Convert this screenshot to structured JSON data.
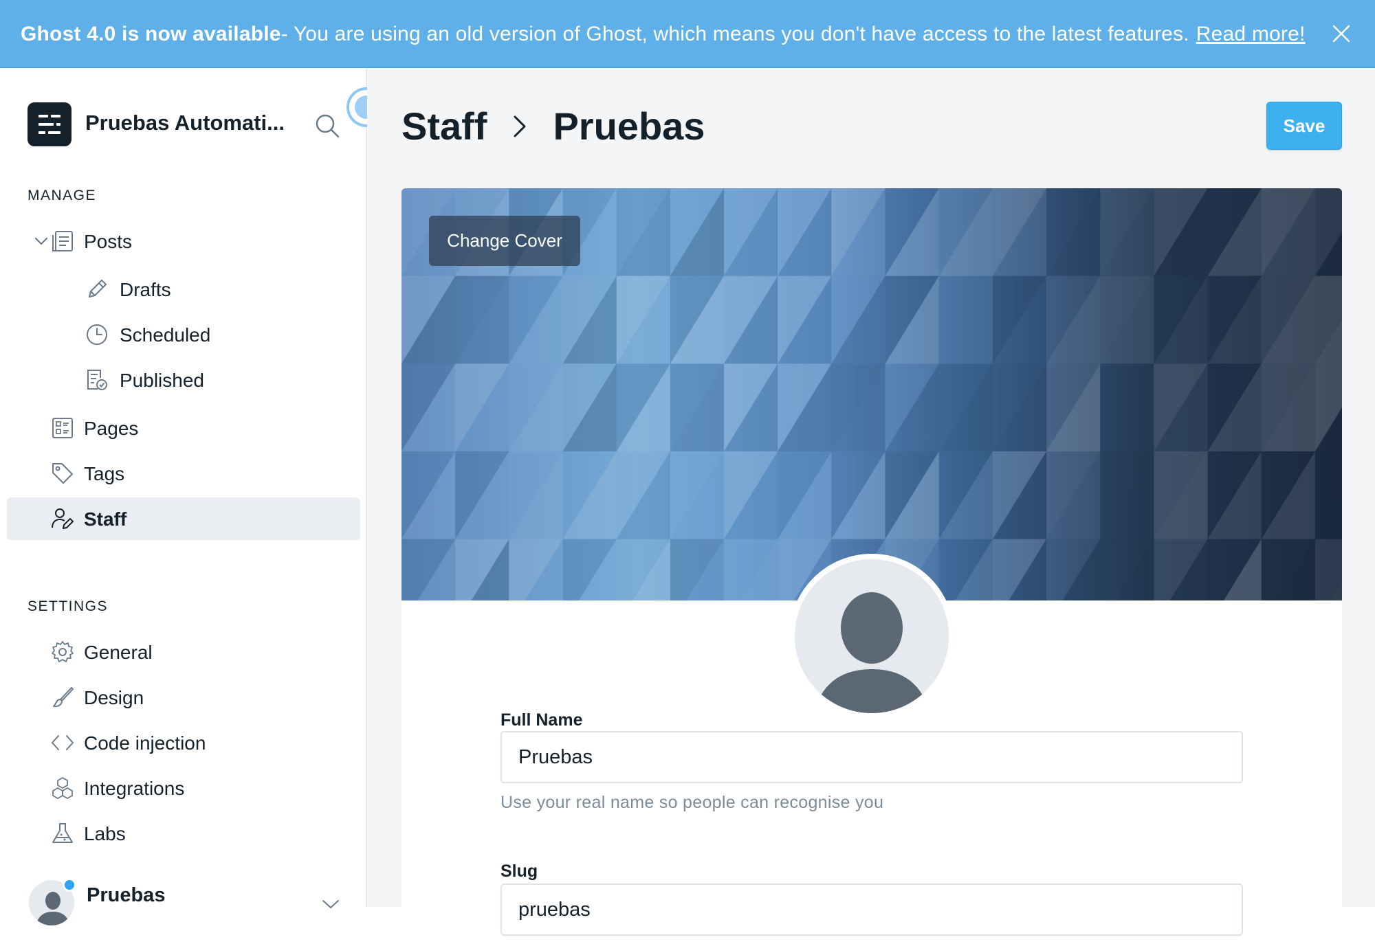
{
  "banner": {
    "title": "Ghost 4.0 is now available",
    "message": " - You are using an old version of Ghost, which means you don't have access to the latest features.",
    "link": "Read more!"
  },
  "sidebar": {
    "site_title": "Pruebas Automati...",
    "manage_heading": "MANAGE",
    "settings_heading": "SETTINGS",
    "items": {
      "posts": "Posts",
      "drafts": "Drafts",
      "scheduled": "Scheduled",
      "published": "Published",
      "pages": "Pages",
      "tags": "Tags",
      "staff": "Staff",
      "general": "General",
      "design": "Design",
      "code_injection": "Code injection",
      "integrations": "Integrations",
      "labs": "Labs"
    },
    "user": {
      "name": "Pruebas"
    }
  },
  "header": {
    "crumb_parent": "Staff",
    "crumb_current": "Pruebas",
    "save_label": "Save"
  },
  "profile": {
    "change_cover_label": "Change Cover",
    "full_name_label": "Full Name",
    "full_name_value": "Pruebas",
    "full_name_help": "Use your real name so people can recognise you",
    "slug_label": "Slug",
    "slug_value": "pruebas"
  },
  "colors": {
    "banner": "#5fb0e8",
    "accent": "#3eb0ef",
    "sidebar_active": "#eaedf1",
    "text": "#15212a"
  }
}
